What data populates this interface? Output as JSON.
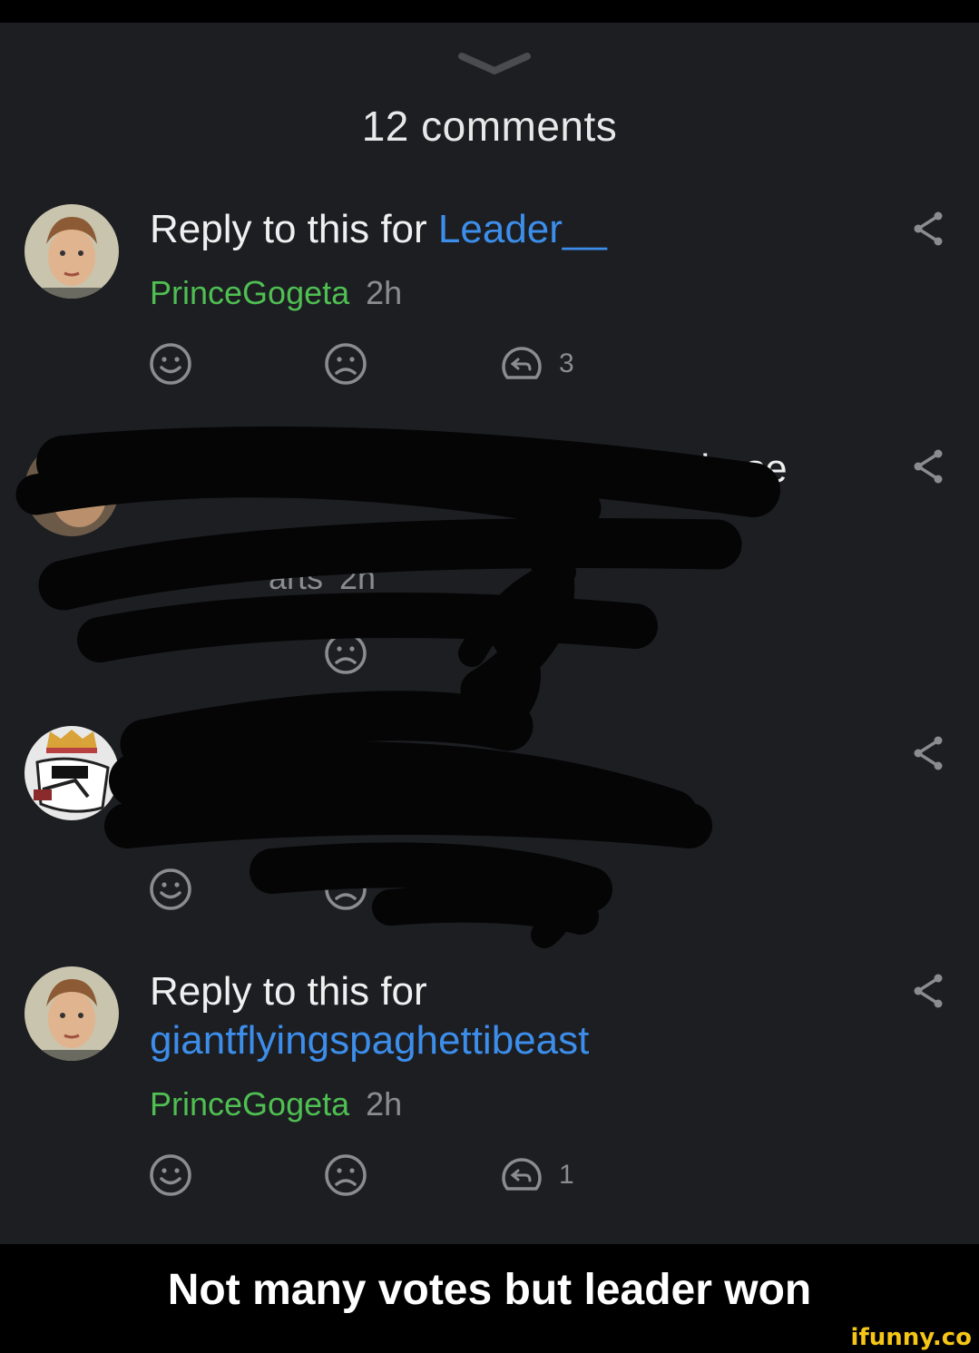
{
  "header": {
    "comment_count": "12 comments"
  },
  "comments": [
    {
      "prefix": "Reply to this for ",
      "mention": "Leader__",
      "author": "PrinceGogeta",
      "time": "2h",
      "reply_count": "3"
    },
    {
      "visible_fragment_1": "these",
      "author_fragment": "arts",
      "time": "2h"
    },
    {
      "text_hidden": true
    },
    {
      "prefix": "Reply to this for",
      "mention": "giantflyingspaghettibeast",
      "author": "PrinceGogeta",
      "time": "2h",
      "reply_count": "1"
    }
  ],
  "caption": "Not many votes but leader won",
  "watermark": "ifunny.co",
  "colors": {
    "background": "#1c1e22",
    "mention": "#3d8eea",
    "author": "#4fbf52",
    "muted": "#8a8c90"
  },
  "icons": [
    "chevron-down-icon",
    "smile-icon",
    "frown-icon",
    "reply-icon",
    "share-icon"
  ]
}
